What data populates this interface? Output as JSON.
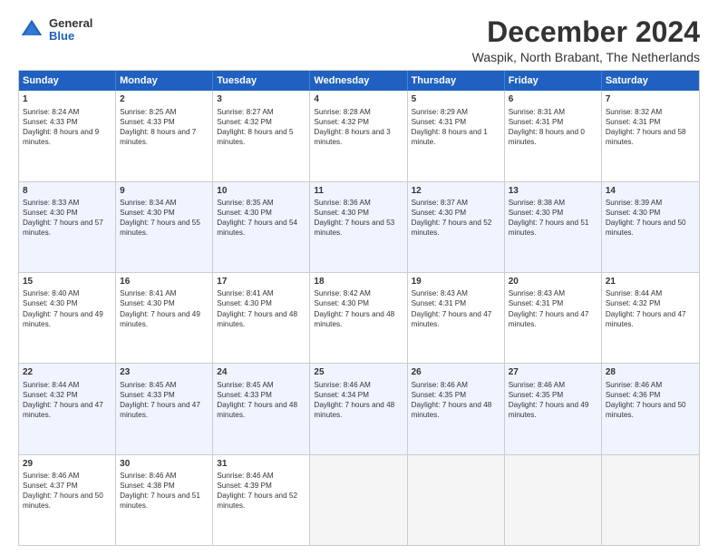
{
  "header": {
    "logo": {
      "general": "General",
      "blue": "Blue"
    },
    "title": "December 2024",
    "subtitle": "Waspik, North Brabant, The Netherlands"
  },
  "calendar": {
    "weekdays": [
      "Sunday",
      "Monday",
      "Tuesday",
      "Wednesday",
      "Thursday",
      "Friday",
      "Saturday"
    ],
    "rows": [
      [
        {
          "day": "1",
          "sunrise": "Sunrise: 8:24 AM",
          "sunset": "Sunset: 4:33 PM",
          "daylight": "Daylight: 8 hours and 9 minutes."
        },
        {
          "day": "2",
          "sunrise": "Sunrise: 8:25 AM",
          "sunset": "Sunset: 4:33 PM",
          "daylight": "Daylight: 8 hours and 7 minutes."
        },
        {
          "day": "3",
          "sunrise": "Sunrise: 8:27 AM",
          "sunset": "Sunset: 4:32 PM",
          "daylight": "Daylight: 8 hours and 5 minutes."
        },
        {
          "day": "4",
          "sunrise": "Sunrise: 8:28 AM",
          "sunset": "Sunset: 4:32 PM",
          "daylight": "Daylight: 8 hours and 3 minutes."
        },
        {
          "day": "5",
          "sunrise": "Sunrise: 8:29 AM",
          "sunset": "Sunset: 4:31 PM",
          "daylight": "Daylight: 8 hours and 1 minute."
        },
        {
          "day": "6",
          "sunrise": "Sunrise: 8:31 AM",
          "sunset": "Sunset: 4:31 PM",
          "daylight": "Daylight: 8 hours and 0 minutes."
        },
        {
          "day": "7",
          "sunrise": "Sunrise: 8:32 AM",
          "sunset": "Sunset: 4:31 PM",
          "daylight": "Daylight: 7 hours and 58 minutes."
        }
      ],
      [
        {
          "day": "8",
          "sunrise": "Sunrise: 8:33 AM",
          "sunset": "Sunset: 4:30 PM",
          "daylight": "Daylight: 7 hours and 57 minutes."
        },
        {
          "day": "9",
          "sunrise": "Sunrise: 8:34 AM",
          "sunset": "Sunset: 4:30 PM",
          "daylight": "Daylight: 7 hours and 55 minutes."
        },
        {
          "day": "10",
          "sunrise": "Sunrise: 8:35 AM",
          "sunset": "Sunset: 4:30 PM",
          "daylight": "Daylight: 7 hours and 54 minutes."
        },
        {
          "day": "11",
          "sunrise": "Sunrise: 8:36 AM",
          "sunset": "Sunset: 4:30 PM",
          "daylight": "Daylight: 7 hours and 53 minutes."
        },
        {
          "day": "12",
          "sunrise": "Sunrise: 8:37 AM",
          "sunset": "Sunset: 4:30 PM",
          "daylight": "Daylight: 7 hours and 52 minutes."
        },
        {
          "day": "13",
          "sunrise": "Sunrise: 8:38 AM",
          "sunset": "Sunset: 4:30 PM",
          "daylight": "Daylight: 7 hours and 51 minutes."
        },
        {
          "day": "14",
          "sunrise": "Sunrise: 8:39 AM",
          "sunset": "Sunset: 4:30 PM",
          "daylight": "Daylight: 7 hours and 50 minutes."
        }
      ],
      [
        {
          "day": "15",
          "sunrise": "Sunrise: 8:40 AM",
          "sunset": "Sunset: 4:30 PM",
          "daylight": "Daylight: 7 hours and 49 minutes."
        },
        {
          "day": "16",
          "sunrise": "Sunrise: 8:41 AM",
          "sunset": "Sunset: 4:30 PM",
          "daylight": "Daylight: 7 hours and 49 minutes."
        },
        {
          "day": "17",
          "sunrise": "Sunrise: 8:41 AM",
          "sunset": "Sunset: 4:30 PM",
          "daylight": "Daylight: 7 hours and 48 minutes."
        },
        {
          "day": "18",
          "sunrise": "Sunrise: 8:42 AM",
          "sunset": "Sunset: 4:30 PM",
          "daylight": "Daylight: 7 hours and 48 minutes."
        },
        {
          "day": "19",
          "sunrise": "Sunrise: 8:43 AM",
          "sunset": "Sunset: 4:31 PM",
          "daylight": "Daylight: 7 hours and 47 minutes."
        },
        {
          "day": "20",
          "sunrise": "Sunrise: 8:43 AM",
          "sunset": "Sunset: 4:31 PM",
          "daylight": "Daylight: 7 hours and 47 minutes."
        },
        {
          "day": "21",
          "sunrise": "Sunrise: 8:44 AM",
          "sunset": "Sunset: 4:32 PM",
          "daylight": "Daylight: 7 hours and 47 minutes."
        }
      ],
      [
        {
          "day": "22",
          "sunrise": "Sunrise: 8:44 AM",
          "sunset": "Sunset: 4:32 PM",
          "daylight": "Daylight: 7 hours and 47 minutes."
        },
        {
          "day": "23",
          "sunrise": "Sunrise: 8:45 AM",
          "sunset": "Sunset: 4:33 PM",
          "daylight": "Daylight: 7 hours and 47 minutes."
        },
        {
          "day": "24",
          "sunrise": "Sunrise: 8:45 AM",
          "sunset": "Sunset: 4:33 PM",
          "daylight": "Daylight: 7 hours and 48 minutes."
        },
        {
          "day": "25",
          "sunrise": "Sunrise: 8:46 AM",
          "sunset": "Sunset: 4:34 PM",
          "daylight": "Daylight: 7 hours and 48 minutes."
        },
        {
          "day": "26",
          "sunrise": "Sunrise: 8:46 AM",
          "sunset": "Sunset: 4:35 PM",
          "daylight": "Daylight: 7 hours and 48 minutes."
        },
        {
          "day": "27",
          "sunrise": "Sunrise: 8:46 AM",
          "sunset": "Sunset: 4:35 PM",
          "daylight": "Daylight: 7 hours and 49 minutes."
        },
        {
          "day": "28",
          "sunrise": "Sunrise: 8:46 AM",
          "sunset": "Sunset: 4:36 PM",
          "daylight": "Daylight: 7 hours and 50 minutes."
        }
      ],
      [
        {
          "day": "29",
          "sunrise": "Sunrise: 8:46 AM",
          "sunset": "Sunset: 4:37 PM",
          "daylight": "Daylight: 7 hours and 50 minutes."
        },
        {
          "day": "30",
          "sunrise": "Sunrise: 8:46 AM",
          "sunset": "Sunset: 4:38 PM",
          "daylight": "Daylight: 7 hours and 51 minutes."
        },
        {
          "day": "31",
          "sunrise": "Sunrise: 8:46 AM",
          "sunset": "Sunset: 4:39 PM",
          "daylight": "Daylight: 7 hours and 52 minutes."
        },
        {
          "day": "",
          "empty": true
        },
        {
          "day": "",
          "empty": true
        },
        {
          "day": "",
          "empty": true
        },
        {
          "day": "",
          "empty": true
        }
      ]
    ]
  }
}
